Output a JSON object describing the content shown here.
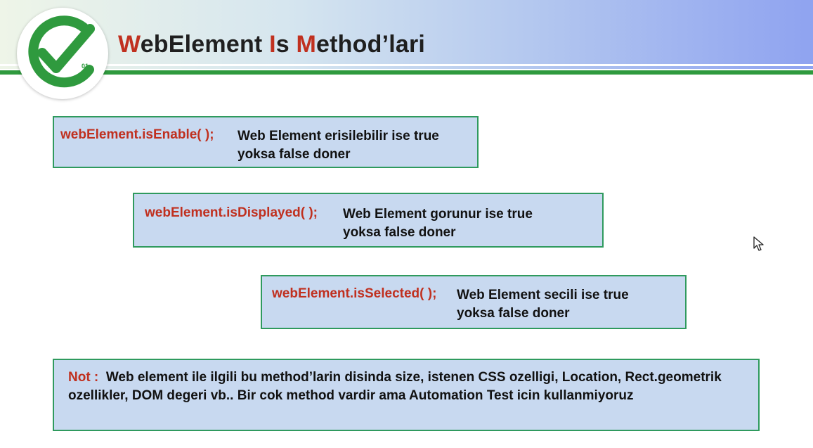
{
  "title": {
    "part1_letter": "W",
    "part1_rest": "ebElement ",
    "part2_letter": "I",
    "part2_rest": "s ",
    "part3_letter": "M",
    "part3_rest": "ethod’lari"
  },
  "logo": {
    "icon": "check-icon",
    "binary_text": "01",
    "brand_green": "#2f9a3e"
  },
  "methods": [
    {
      "code": "webElement.isEnable( );",
      "line1": "Web Element erisilebilir ise true",
      "line2": "yoksa false doner"
    },
    {
      "code": "webElement.isDisplayed( );",
      "line1": "Web Element gorunur ise true",
      "line2": "yoksa false doner"
    },
    {
      "code": "webElement.isSelected( );",
      "line1": "Web Element secili ise true",
      "line2": "yoksa false doner"
    }
  ],
  "note": {
    "label": "Not :",
    "text": "Web element ile ilgili bu method’larin disinda size, istenen CSS ozelligi, Location, Rect.geometrik ozellikler, DOM degeri vb.. Bir cok method vardir ama Automation Test icin kullanmiyoruz"
  },
  "colors": {
    "accent_red": "#c0301f",
    "box_fill": "#c8d9f0",
    "box_border": "#2f9a5e"
  },
  "cursor_icon": "mouse-pointer-icon"
}
